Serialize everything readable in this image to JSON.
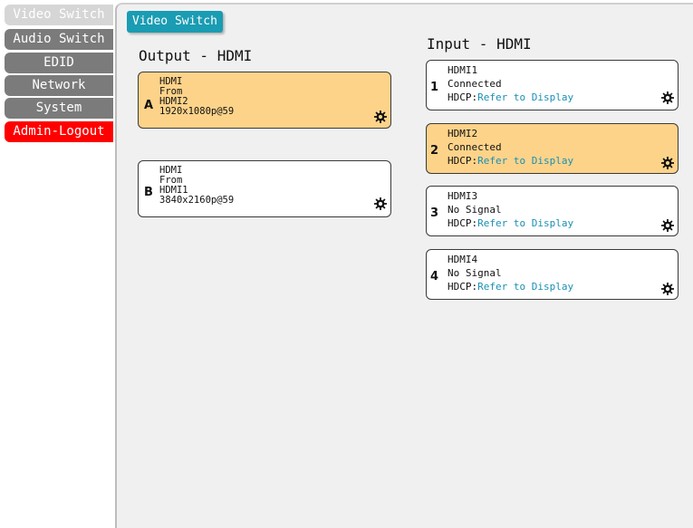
{
  "sidebar": {
    "items": [
      {
        "label": "Video Switch",
        "active": true
      },
      {
        "label": "Audio Switch"
      },
      {
        "label": "EDID"
      },
      {
        "label": "Network"
      },
      {
        "label": "System"
      },
      {
        "label": "Admin-Logout"
      }
    ]
  },
  "tab": {
    "label": "Video Switch"
  },
  "output_section": {
    "title": "Output - HDMI",
    "outputs": [
      {
        "letter": "A",
        "type": "HDMI",
        "from_label": "From",
        "source": "HDMI2",
        "resolution": "1920x1080p@59",
        "highlighted": true
      },
      {
        "letter": "B",
        "type": "HDMI",
        "from_label": "From",
        "source": "HDMI1",
        "resolution": "3840x2160p@59",
        "highlighted": false
      }
    ]
  },
  "input_section": {
    "title": "Input - HDMI",
    "inputs": [
      {
        "number": "1",
        "name": "HDMI1",
        "status": "Connected",
        "hdcp_label": "HDCP:",
        "hdcp_value": "Refer to Display",
        "highlighted": false
      },
      {
        "number": "2",
        "name": "HDMI2",
        "status": "Connected",
        "hdcp_label": "HDCP:",
        "hdcp_value": "Refer to Display",
        "highlighted": true
      },
      {
        "number": "3",
        "name": "HDMI3",
        "status": "No Signal",
        "hdcp_label": "HDCP:",
        "hdcp_value": "Refer to Display",
        "highlighted": false
      },
      {
        "number": "4",
        "name": "HDMI4",
        "status": "No Signal",
        "hdcp_label": "HDCP:",
        "hdcp_value": "Refer to Display",
        "highlighted": false
      }
    ]
  },
  "colors": {
    "accent": "#1a9cb3",
    "highlight": "#fdd38a",
    "logout": "#ff0000",
    "nav_bg": "#7b7b7b",
    "hdcp_text": "#1a8fb5"
  }
}
